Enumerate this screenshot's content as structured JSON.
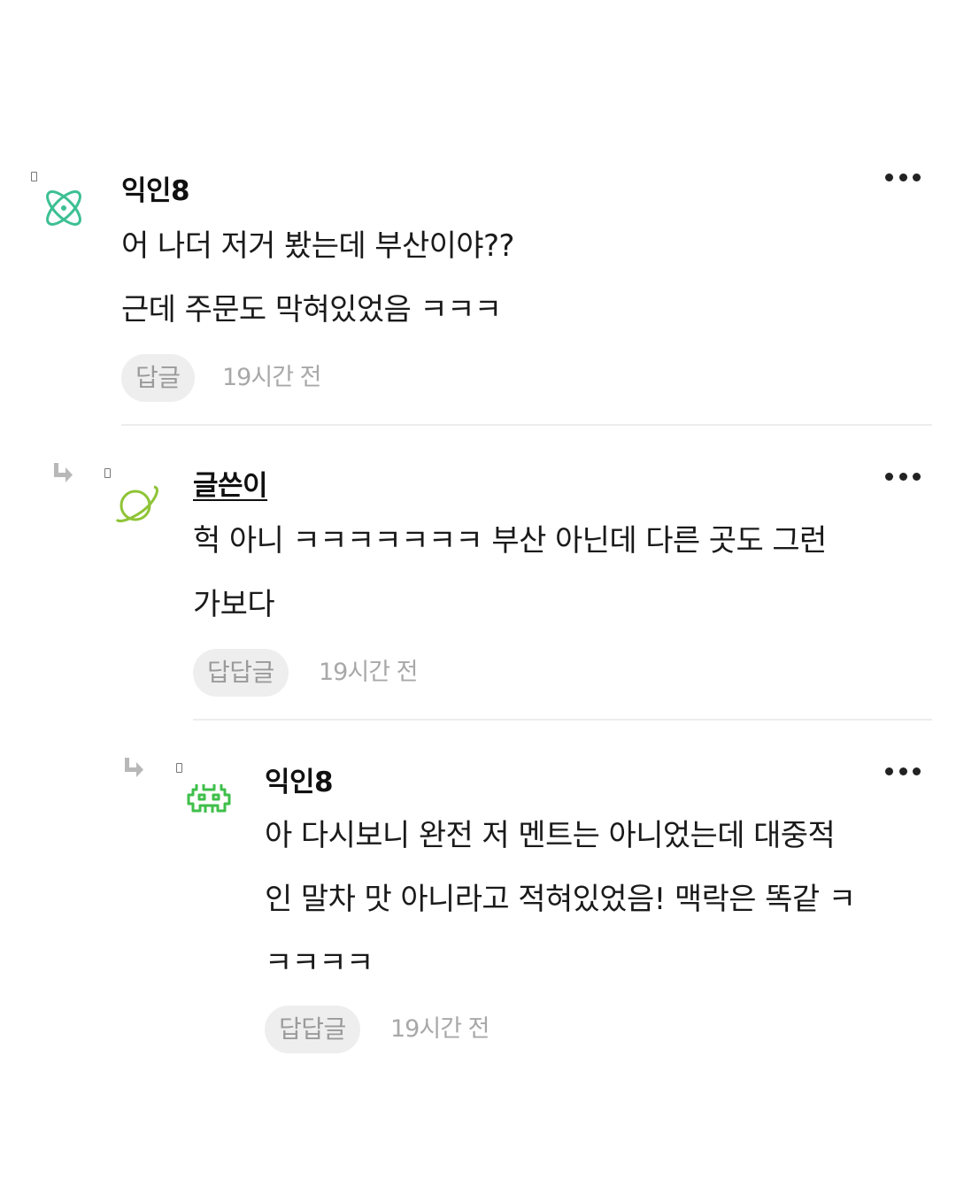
{
  "comments": [
    {
      "author": "익인8",
      "is_op": false,
      "avatar_icon": "atom-icon",
      "avatar_color": "#3dbf94",
      "lines": [
        "어 나더 저거 봤는데 부산이야??",
        "근데 주문도 막혀있었음 ㅋㅋㅋ"
      ],
      "reply_label": "답글",
      "time": "19시간 전"
    },
    {
      "author": "글쓴이",
      "is_op": true,
      "avatar_icon": "planet-icon",
      "avatar_color": "#8fc436",
      "lines": [
        "헉 아니 ㅋㅋㅋㅋㅋㅋㅋ 부산 아닌데 다른 곳도 그런",
        "가보다"
      ],
      "reply_label": "답답글",
      "time": "19시간 전"
    },
    {
      "author": "익인8",
      "is_op": false,
      "avatar_icon": "space-invader-icon",
      "avatar_color": "#3fbf4a",
      "lines": [
        "아 다시보니 완전 저 멘트는 아니었는데 대중적",
        "인 말차 맛 아니라고 적혀있었음! 맥락은 똑같 ㅋ",
        "ㅋㅋㅋㅋ"
      ],
      "reply_label": "답답글",
      "time": "19시간 전"
    }
  ]
}
